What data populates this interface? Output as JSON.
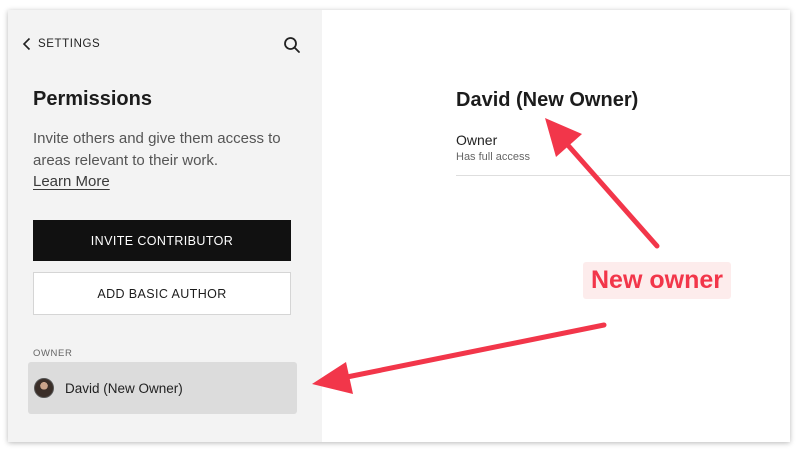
{
  "sidebar": {
    "back_label": "SETTINGS",
    "title": "Permissions",
    "description": "Invite others and give them access to areas relevant to their work.",
    "learn_more": "Learn More",
    "invite_button": "INVITE CONTRIBUTOR",
    "add_author_button": "ADD BASIC AUTHOR",
    "owner_section_label": "OWNER",
    "owner_name": "David (New Owner)"
  },
  "main": {
    "title": "David (New Owner)",
    "role": "Owner",
    "role_description": "Has full access"
  },
  "annotation": {
    "label": "New owner",
    "color": "#f2364a"
  },
  "icons": {
    "back": "chevron-left-icon",
    "search": "search-icon",
    "avatar": "user-avatar"
  }
}
